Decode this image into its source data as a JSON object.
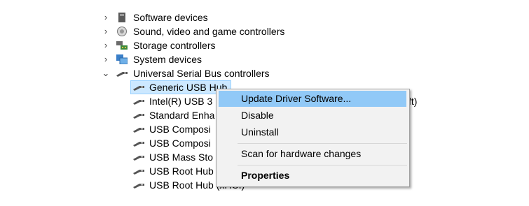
{
  "tree": {
    "categories": [
      {
        "label": "Software devices",
        "icon": "software-device-icon",
        "expanded": false
      },
      {
        "label": "Sound, video and game controllers",
        "icon": "speaker-icon",
        "expanded": false
      },
      {
        "label": "Storage controllers",
        "icon": "storage-controller-icon",
        "expanded": false
      },
      {
        "label": "System devices",
        "icon": "system-device-icon",
        "expanded": false
      },
      {
        "label": "Universal Serial Bus controllers",
        "icon": "usb-icon",
        "expanded": true
      }
    ],
    "usb_children": [
      {
        "label": "Generic USB Hub",
        "icon": "usb-plug-icon",
        "selected": true
      },
      {
        "label": "Intel(R) USB 3",
        "tail": "ft)",
        "icon": "usb-plug-icon"
      },
      {
        "label": "Standard Enha",
        "icon": "usb-plug-icon"
      },
      {
        "label": "USB Composi",
        "icon": "usb-plug-icon"
      },
      {
        "label": "USB Composi",
        "icon": "usb-plug-icon"
      },
      {
        "label": "USB Mass Sto",
        "icon": "usb-plug-icon"
      },
      {
        "label": "USB Root Hub",
        "icon": "usb-plug-icon"
      },
      {
        "label": "USB Root Hub (xHCI)",
        "icon": "usb-plug-icon"
      }
    ]
  },
  "context_menu": {
    "items": [
      {
        "label": "Update Driver Software...",
        "highlighted": true
      },
      {
        "label": "Disable"
      },
      {
        "label": "Uninstall"
      },
      {
        "label": "Scan for hardware changes"
      },
      {
        "label": "Properties",
        "bold": true
      }
    ],
    "highlight_color": "#91c9f7"
  },
  "colors": {
    "selection": "#cce8ff",
    "menu_bg": "#f2f2f2"
  }
}
